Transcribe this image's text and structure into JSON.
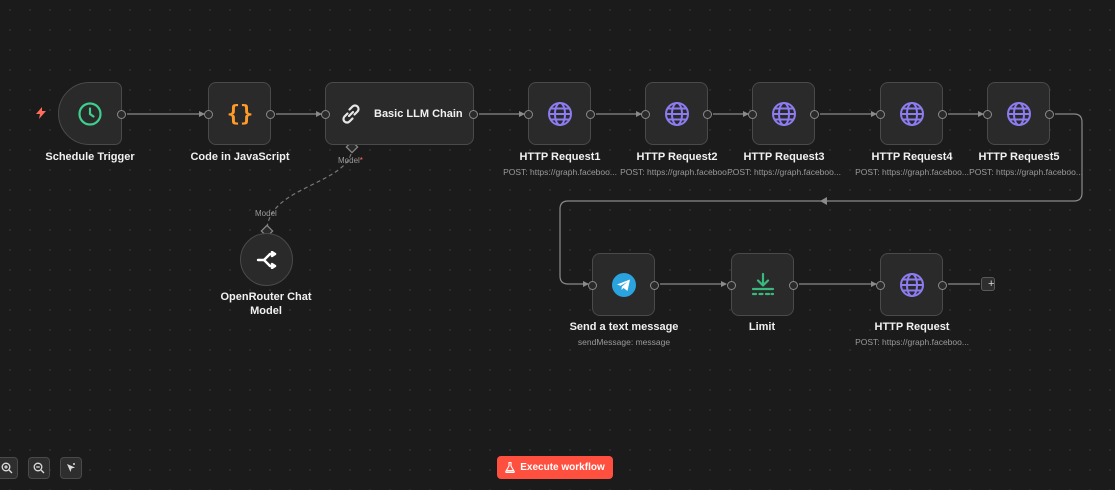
{
  "canvas": {
    "nodes": {
      "schedule_trigger": {
        "title": "Schedule Trigger",
        "icon": "clock-icon"
      },
      "code_js": {
        "title": "Code in JavaScript",
        "icon": "curly-braces-icon"
      },
      "llm_chain": {
        "title": "Basic LLM Chain",
        "icon": "link-icon",
        "model_port_label": "Model",
        "required_mark": "*"
      },
      "openrouter": {
        "title": "OpenRouter Chat Model",
        "icon": "openrouter-icon",
        "model_port_label": "Model"
      },
      "http1": {
        "title": "HTTP Request1",
        "subtitle": "POST: https://graph.faceboo...",
        "icon": "globe-icon"
      },
      "http2": {
        "title": "HTTP Request2",
        "subtitle": "POST: https://graph.faceboo...",
        "icon": "globe-icon"
      },
      "http3": {
        "title": "HTTP Request3",
        "subtitle": "POST: https://graph.faceboo...",
        "icon": "globe-icon"
      },
      "http4": {
        "title": "HTTP Request4",
        "subtitle": "POST: https://graph.faceboo...",
        "icon": "globe-icon"
      },
      "http5": {
        "title": "HTTP Request5",
        "subtitle": "POST: https://graph.faceboo...",
        "icon": "globe-icon"
      },
      "telegram": {
        "title": "Send a text message",
        "subtitle": "sendMessage: message",
        "icon": "telegram-icon"
      },
      "limit": {
        "title": "Limit",
        "icon": "limit-icon"
      },
      "http": {
        "title": "HTTP Request",
        "subtitle": "POST: https://graph.faceboo...",
        "icon": "globe-icon"
      }
    },
    "add_node_label": "+"
  },
  "toolbar": {
    "zoom_in": "zoom-in-icon",
    "zoom_out": "zoom-out-icon",
    "tidy": "cursor-sparkle-icon",
    "execute_label": "Execute workflow",
    "execute_icon": "flask-icon"
  },
  "colors": {
    "background": "#1b1b1b",
    "node": "#2a2a2a",
    "node_border": "#4a4a4a",
    "trigger_green": "#3ecf8e",
    "code_orange": "#ff9b26",
    "http_purple": "#8c7cf0",
    "telegram_blue": "#2aa3df",
    "limit_green": "#39b97e",
    "execute_red": "#ff4f3f"
  }
}
